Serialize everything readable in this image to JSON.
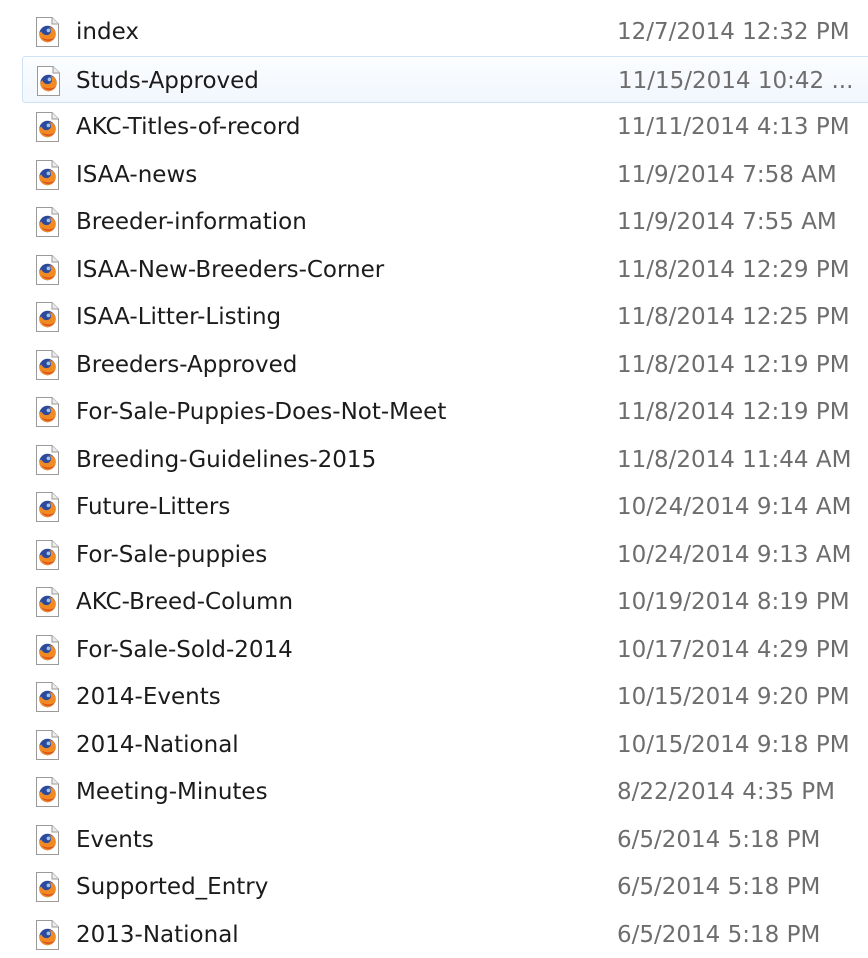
{
  "files": [
    {
      "name": "index",
      "date": "12/7/2014 12:32 PM",
      "icon": "firefox-html-file-icon",
      "selected": false
    },
    {
      "name": "Studs-Approved",
      "date": "11/15/2014 10:42 ...",
      "icon": "firefox-html-file-icon",
      "selected": true
    },
    {
      "name": "AKC-Titles-of-record",
      "date": "11/11/2014 4:13 PM",
      "icon": "firefox-html-file-icon",
      "selected": false
    },
    {
      "name": "ISAA-news",
      "date": "11/9/2014 7:58 AM",
      "icon": "firefox-html-file-icon",
      "selected": false
    },
    {
      "name": "Breeder-information",
      "date": "11/9/2014 7:55 AM",
      "icon": "firefox-html-file-icon",
      "selected": false
    },
    {
      "name": "ISAA-New-Breeders-Corner",
      "date": "11/8/2014 12:29 PM",
      "icon": "firefox-html-file-icon",
      "selected": false
    },
    {
      "name": "ISAA-Litter-Listing",
      "date": "11/8/2014 12:25 PM",
      "icon": "firefox-html-file-icon",
      "selected": false
    },
    {
      "name": "Breeders-Approved",
      "date": "11/8/2014 12:19 PM",
      "icon": "firefox-html-file-icon",
      "selected": false
    },
    {
      "name": "For-Sale-Puppies-Does-Not-Meet",
      "date": "11/8/2014 12:19 PM",
      "icon": "firefox-html-file-icon",
      "selected": false
    },
    {
      "name": "Breeding-Guidelines-2015",
      "date": "11/8/2014 11:44 AM",
      "icon": "firefox-html-file-icon",
      "selected": false
    },
    {
      "name": "Future-Litters",
      "date": "10/24/2014 9:14 AM",
      "icon": "firefox-html-file-icon",
      "selected": false
    },
    {
      "name": "For-Sale-puppies",
      "date": "10/24/2014 9:13 AM",
      "icon": "firefox-html-file-icon",
      "selected": false
    },
    {
      "name": "AKC-Breed-Column",
      "date": "10/19/2014 8:19 PM",
      "icon": "firefox-html-file-icon",
      "selected": false
    },
    {
      "name": "For-Sale-Sold-2014",
      "date": "10/17/2014 4:29 PM",
      "icon": "firefox-html-file-icon",
      "selected": false
    },
    {
      "name": "2014-Events",
      "date": "10/15/2014 9:20 PM",
      "icon": "firefox-html-file-icon",
      "selected": false
    },
    {
      "name": "2014-National",
      "date": "10/15/2014 9:18 PM",
      "icon": "firefox-html-file-icon",
      "selected": false
    },
    {
      "name": "Meeting-Minutes",
      "date": "8/22/2014 4:35 PM",
      "icon": "firefox-html-file-icon",
      "selected": false
    },
    {
      "name": "Events",
      "date": "6/5/2014 5:18 PM",
      "icon": "firefox-html-file-icon",
      "selected": false
    },
    {
      "name": "Supported_Entry",
      "date": "6/5/2014 5:18 PM",
      "icon": "firefox-html-file-icon",
      "selected": false
    },
    {
      "name": "2013-National",
      "date": "6/5/2014 5:18 PM",
      "icon": "firefox-html-file-icon",
      "selected": false
    }
  ],
  "colors": {
    "selection_border": "#cfe1f5",
    "name_text": "#1b1b1b",
    "date_text": "#6d6d6d"
  }
}
